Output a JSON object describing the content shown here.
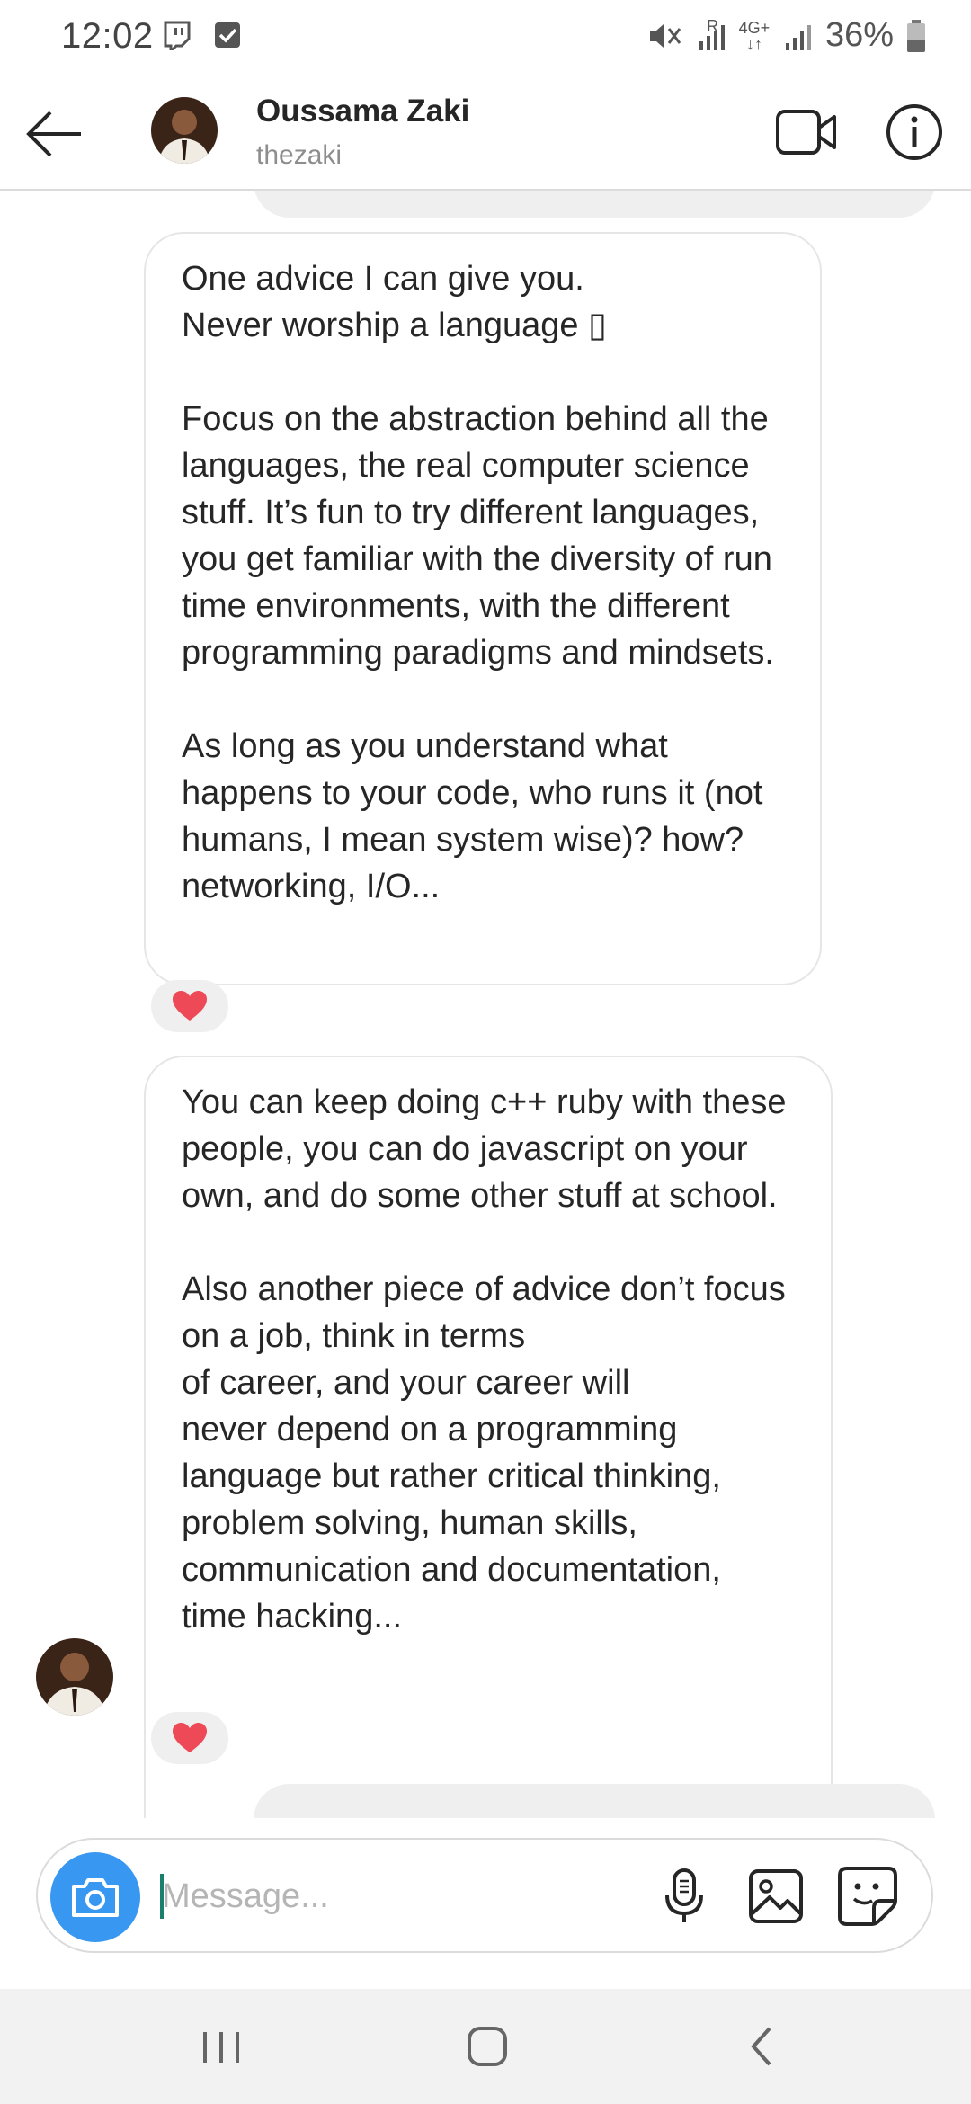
{
  "status_bar": {
    "time": "12:02",
    "battery": "36%",
    "network": "4G+",
    "roaming": "R",
    "icons": [
      "twitch-icon",
      "check-box-icon",
      "mute-icon",
      "signal-icon",
      "battery-icon"
    ]
  },
  "header": {
    "name": "Oussama Zaki",
    "username": "thezaki",
    "back_icon": "arrow-left-icon",
    "video_icon": "video-camera-icon",
    "info_icon": "info-icon"
  },
  "messages": [
    {
      "text": "One advice I can give you.\nNever worship a language ▯\n\nFocus on the abstraction behind all the languages, the real computer science stuff. It’s fun to try different languages, you get familiar with the diversity of run time environments, with the different programming paradigms and mindsets.\n\nAs long as you understand what happens to your code, who runs it (not humans, I mean system wise)? how? networking, I/O...",
      "reaction": "❤️"
    },
    {
      "text": "You can keep doing c++ ruby with these people, you can do javascript on your own, and do some other stuff at school.\n\nAlso another piece of advice don’t focus on a job, think in terms\nof career, and your career will\nnever depend on a programming language but rather critical thinking, problem solving, human skills, communication and documentation, time hacking...",
      "reaction": "❤️"
    }
  ],
  "composer": {
    "placeholder": "Message...",
    "value": "",
    "camera_icon": "camera-icon",
    "mic_icon": "microphone-icon",
    "gallery_icon": "image-icon",
    "sticker_icon": "sticker-icon"
  },
  "colors": {
    "accent": "#3897f0",
    "heart": "#ed4956",
    "bubble_border": "#e6e6e6",
    "reaction_bg": "#efefef",
    "caret": "#1a7f6b"
  }
}
